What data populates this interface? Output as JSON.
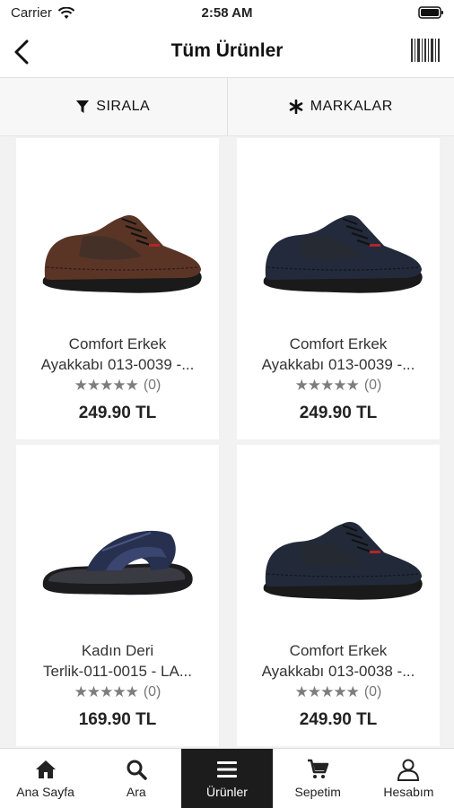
{
  "status": {
    "carrier": "Carrier",
    "time": "2:58 AM"
  },
  "nav": {
    "title": "Tüm Ürünler"
  },
  "filters": {
    "sort_label": "SIRALA",
    "brands_label": "MARKALAR"
  },
  "products": [
    {
      "name_line1": "Comfort Erkek",
      "name_line2": "Ayakkabı 013-0039 -...",
      "rating_count": "(0)",
      "price": "249.90 TL",
      "shoe_type": "sneaker",
      "color": "#5a3526"
    },
    {
      "name_line1": "Comfort Erkek",
      "name_line2": "Ayakkabı 013-0039 -...",
      "rating_count": "(0)",
      "price": "249.90 TL",
      "shoe_type": "sneaker",
      "color": "#232a3b"
    },
    {
      "name_line1": "Kadın Deri",
      "name_line2": "Terlik-011-0015 - LA...",
      "rating_count": "(0)",
      "price": "169.90 TL",
      "shoe_type": "sandal",
      "color": "#27304f"
    },
    {
      "name_line1": "Comfort Erkek",
      "name_line2": "Ayakkabı 013-0038 -...",
      "rating_count": "(0)",
      "price": "249.90 TL",
      "shoe_type": "sneaker",
      "color": "#222a3a"
    }
  ],
  "tabs": [
    {
      "label": "Ana Sayfa",
      "icon": "home-icon"
    },
    {
      "label": "Ara",
      "icon": "search-icon"
    },
    {
      "label": "Ürünler",
      "icon": "menu-icon",
      "active": true
    },
    {
      "label": "Sepetim",
      "icon": "cart-icon"
    },
    {
      "label": "Hesabım",
      "icon": "user-icon"
    }
  ]
}
